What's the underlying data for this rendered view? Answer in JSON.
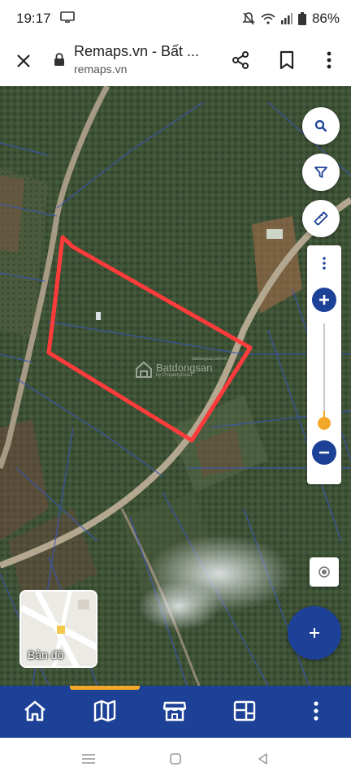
{
  "status_bar": {
    "time": "19:17",
    "battery": "86%",
    "icons": [
      "screen-cast-icon",
      "mute-icon",
      "wifi-icon",
      "signal-icon",
      "battery-icon"
    ]
  },
  "browser": {
    "title": "Remaps.vn - Bất ...",
    "domain": "remaps.vn",
    "icons": [
      "close-icon",
      "lock-icon",
      "share-icon",
      "bookmark-icon",
      "more-vert-icon"
    ]
  },
  "map": {
    "watermark": "Batdongsan",
    "watermark_sub": "by PropertyGuru",
    "watermark_domain": "batdongsan.com.vn",
    "basemap_label": "Bản đồ",
    "parcel_outline_color": "#ff3b3b",
    "controls": [
      "search-icon",
      "filter-icon",
      "ruler-icon",
      "more-vert-icon",
      "zoom-in-icon",
      "zoom-out-icon",
      "locate-icon",
      "add-icon"
    ],
    "zoom_level_fraction": 0.18
  },
  "bottom_nav": {
    "items": [
      "home-icon",
      "map-icon",
      "store-icon",
      "layers-icon",
      "more-vert-icon"
    ],
    "active_index": 1,
    "accent_color": "#f4a82a",
    "background_color": "#1d4196"
  },
  "system_nav": {
    "items": [
      "recents-icon",
      "home-circle-icon",
      "back-icon"
    ]
  }
}
